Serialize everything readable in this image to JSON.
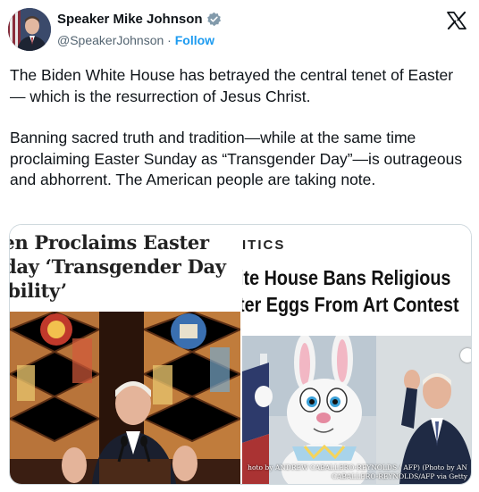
{
  "header": {
    "name": "Speaker Mike Johnson",
    "handle": "@SpeakerJohnson",
    "separator": " · ",
    "follow_label": "Follow",
    "verified_icon": "verified-badge-icon",
    "logo_icon": "x-logo-icon"
  },
  "tweet": {
    "paragraph_1": "The Biden White House has betrayed the central tenet of Easter — which is the resurrection of Jesus Christ.",
    "paragraph_2": "Banning sacred truth and tradition—while at the same time proclaiming Easter Sunday as “Transgender Day”—is outrageous and abhorrent. The American people are taking note."
  },
  "media": {
    "left": {
      "headline": "den Proclaims Easter\nnday ‘Transgender Day\nsibility’"
    },
    "right": {
      "section": "ITICS",
      "headline": "ite House Bans Religious\nter Eggs From Art Contest",
      "credit": "hoto by ANDREW CABALLERO-REYNOLDS / AFP) (Photo by AN\nCABALLERO-REYNOLDS/AFP via Getty"
    }
  },
  "colors": {
    "accent": "#1d9bf0",
    "text": "#0f1419",
    "secondary": "#536471",
    "border": "#cfd9de"
  }
}
